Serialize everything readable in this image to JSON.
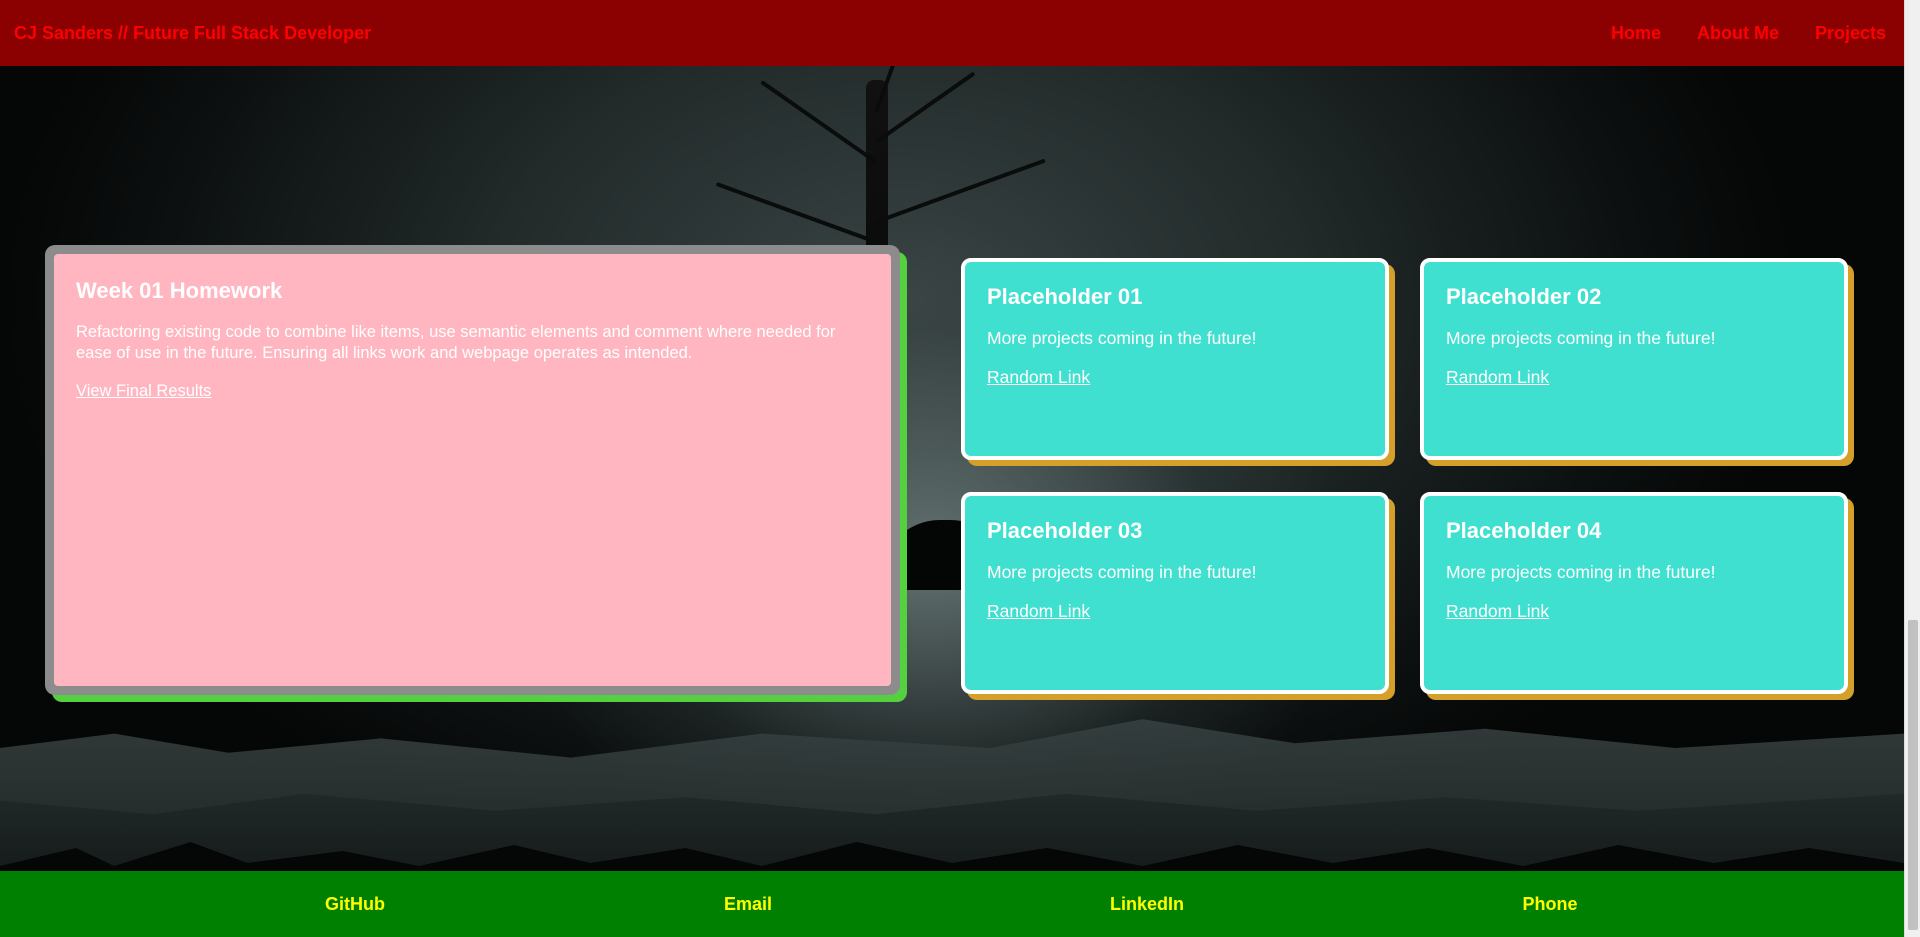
{
  "header": {
    "brand": "CJ Sanders // Future Full Stack Developer",
    "nav": [
      "Home",
      "About Me",
      "Projects"
    ]
  },
  "feature": {
    "title": "Week 01 Homework",
    "description": "Refactoring existing code to combine like items, use semantic elements and comment where needed for ease of use in the future. Ensuring all links work and webpage operates as intended.",
    "link": "View Final Results"
  },
  "cards": [
    {
      "title": "Placeholder 01",
      "text": "More projects coming in the future!",
      "link": "Random Link"
    },
    {
      "title": "Placeholder 02",
      "text": "More projects coming in the future!",
      "link": "Random Link"
    },
    {
      "title": "Placeholder 03",
      "text": "More projects coming in the future!",
      "link": "Random Link"
    },
    {
      "title": "Placeholder 04",
      "text": "More projects coming in the future!",
      "link": "Random Link"
    }
  ],
  "footer": {
    "links": [
      "GitHub",
      "Email",
      "LinkedIn",
      "Phone"
    ]
  },
  "colors": {
    "header_bg": "#8b0000",
    "header_text": "#ff0000",
    "feature_bg": "#ffb6c1",
    "feature_border": "#8c8c8c",
    "feature_shadow": "#55d040",
    "card_bg": "#40e0d0",
    "card_shadow": "#d4a02a",
    "footer_bg": "#008000",
    "footer_text": "#ffff00"
  }
}
